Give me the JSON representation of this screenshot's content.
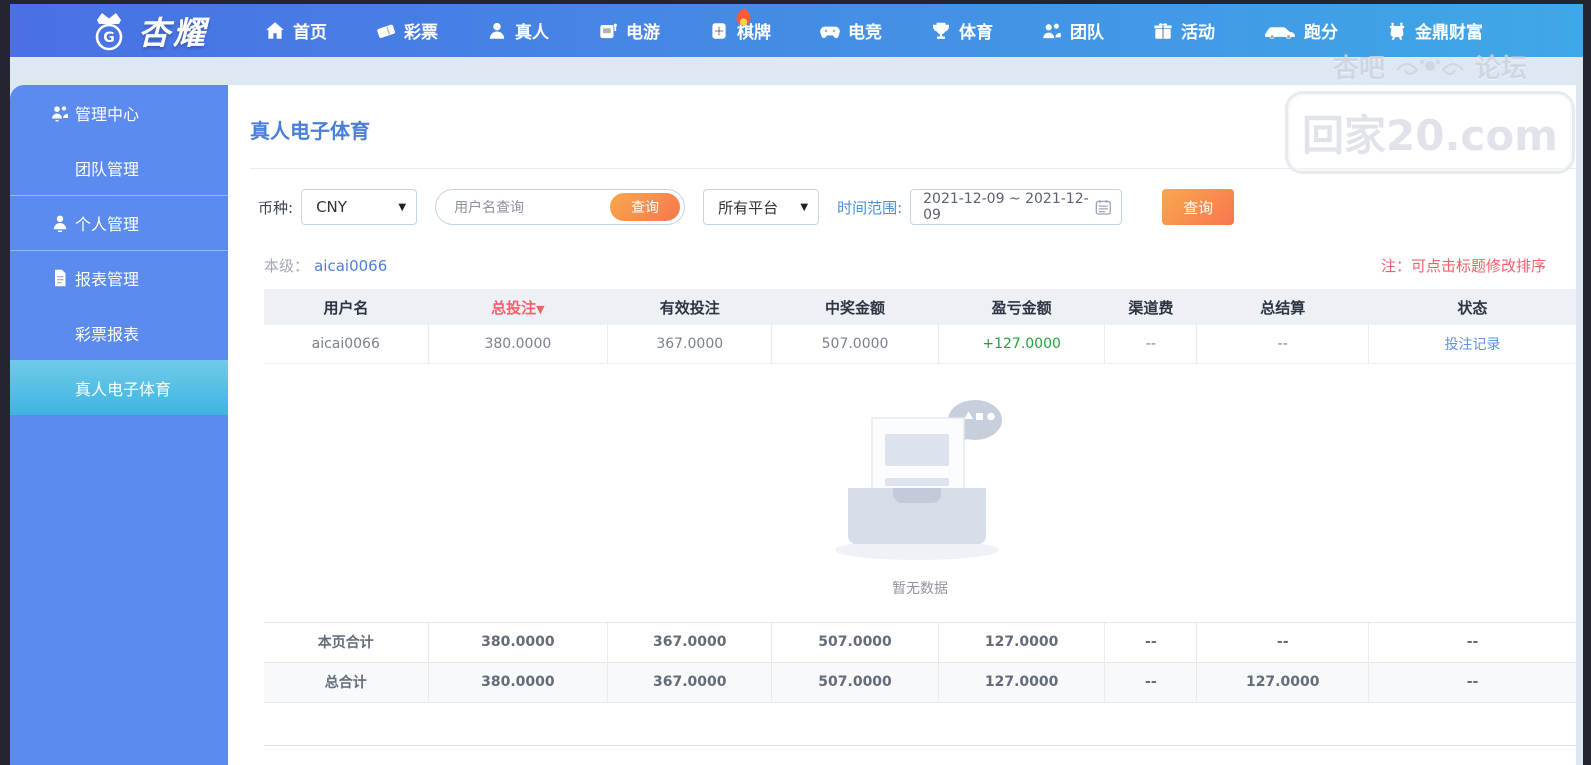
{
  "navbar": {
    "logo_text": "杏耀",
    "items": [
      {
        "label": "首页"
      },
      {
        "label": "彩票"
      },
      {
        "label": "真人"
      },
      {
        "label": "电游"
      },
      {
        "label": "棋牌"
      },
      {
        "label": "电竞"
      },
      {
        "label": "体育"
      },
      {
        "label": "团队"
      },
      {
        "label": "活动"
      },
      {
        "label": "跑分"
      },
      {
        "label": "金鼎财富"
      }
    ]
  },
  "watermark": {
    "left": "杏吧",
    "right": "论坛",
    "domain": "回家20.com"
  },
  "sidebar": {
    "items": [
      {
        "label": "管理中心"
      },
      {
        "label": "团队管理"
      },
      {
        "label": "个人管理"
      },
      {
        "label": "报表管理"
      },
      {
        "label": "彩票报表"
      },
      {
        "label": "真人电子体育"
      }
    ]
  },
  "main": {
    "page_title": "真人电子体育",
    "filters": {
      "currency_label": "币种:",
      "currency_value": "CNY",
      "username_placeholder": "用户名查询",
      "username_search_button": "查询",
      "platform_value": "所有平台",
      "date_label": "时间范围:",
      "date_value": "2021-12-09 ~ 2021-12-09",
      "search_button": "查询"
    },
    "level_label": "本级：",
    "level_user": "aicai0066",
    "sort_note": "注：可点击标题修改排序",
    "table": {
      "headers": [
        "用户名",
        "总投注",
        "有效投注",
        "中奖金额",
        "盈亏金额",
        "渠道费",
        "总结算",
        "状态"
      ],
      "sort_arrow": "▼",
      "rows": [
        {
          "cells": [
            "aicai0066",
            "380.0000",
            "367.0000",
            "507.0000",
            "+127.0000",
            "--",
            "--",
            "投注记录"
          ]
        }
      ],
      "empty_text": "暂无数据",
      "page_total": {
        "label": "本页合计",
        "values": [
          "380.0000",
          "367.0000",
          "507.0000",
          "127.0000",
          "--",
          "--",
          "--"
        ]
      },
      "grand_total": {
        "label": "总合计",
        "values": [
          "380.0000",
          "367.0000",
          "507.0000",
          "127.0000",
          "--",
          "127.0000",
          "--"
        ]
      }
    }
  },
  "colors": {
    "nav_gradient_start": "#4a70e4",
    "nav_gradient_end": "#3fa8e6",
    "sidebar": "#5b8bee",
    "sidebar_active_top": "#70cbe9",
    "sidebar_active_bottom": "#3eb4e2",
    "accent_orange_start": "#f9a84c",
    "accent_orange_end": "#f7764f",
    "title_blue": "#4a7fd9",
    "link_blue": "#5e93e4",
    "note_red": "#f25f6b",
    "profit_green": "#1fa33c"
  }
}
